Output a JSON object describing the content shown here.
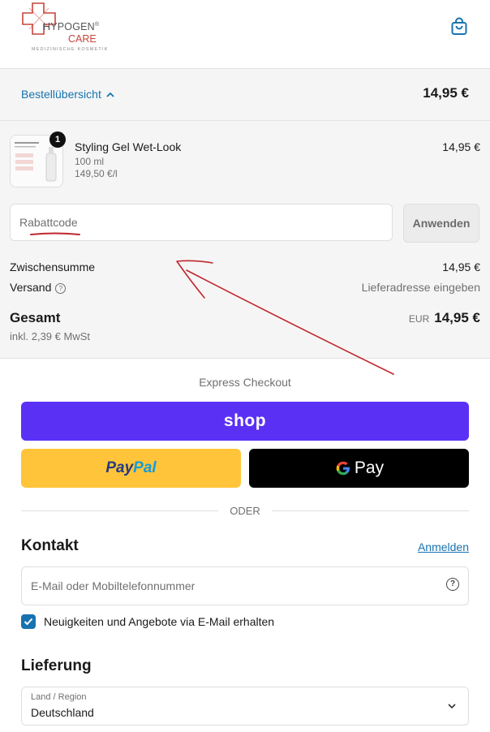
{
  "brand": {
    "name": "HYPOGEN",
    "registered": "®",
    "name2": "CARE",
    "tagline": "MEDIZINISCHE KOSMETIK",
    "accent": "#c6443a"
  },
  "header": {
    "cart_icon": "shopping-bag-icon"
  },
  "summary": {
    "toggle_label": "Bestellübersicht",
    "total": "14,95 €"
  },
  "product": {
    "quantity": "1",
    "name": "Styling Gel Wet-Look",
    "volume": "100 ml",
    "unit_price": "149,50 €/l",
    "price": "14,95 €"
  },
  "discount": {
    "placeholder": "Rabattcode",
    "button": "Anwenden"
  },
  "costs": {
    "subtotal_label": "Zwischensumme",
    "subtotal_value": "14,95 €",
    "shipping_label": "Versand",
    "shipping_value": "Lieferadresse eingeben",
    "total_label": "Gesamt",
    "currency": "EUR",
    "total_value": "14,95 €",
    "tax_note": "inkl. 2,39 € MwSt"
  },
  "express": {
    "label": "Express Checkout",
    "shop": "shop",
    "paypal_part1": "Pay",
    "paypal_part2": "Pal",
    "gpay": "Pay",
    "divider": "ODER",
    "colors": {
      "shop": "#5a31f4",
      "paypal": "#ffc439",
      "gpay": "#000000"
    }
  },
  "contact": {
    "heading": "Kontakt",
    "login": "Anmelden",
    "email_placeholder": "E-Mail oder Mobiltelefonnummer",
    "newsletter_label": "Neuigkeiten und Angebote via E-Mail erhalten",
    "newsletter_checked": true
  },
  "delivery": {
    "heading": "Lieferung",
    "country_label": "Land / Region",
    "country_value": "Deutschland"
  },
  "colors": {
    "link": "#1773b0",
    "annotation": "#c0262d"
  }
}
